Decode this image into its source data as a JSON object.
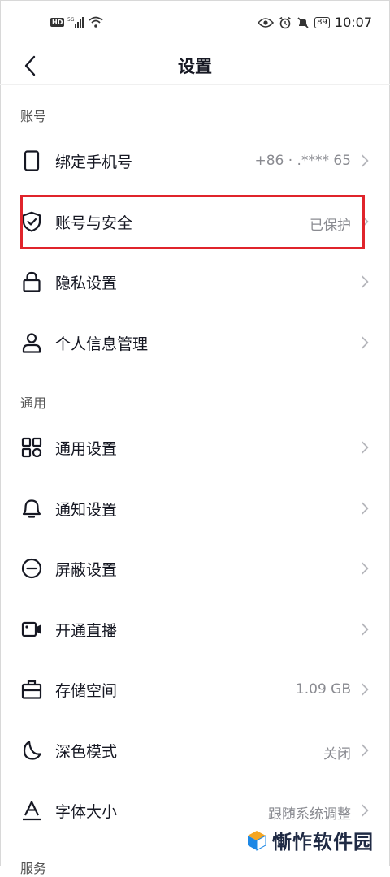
{
  "status_bar": {
    "time": "10:07",
    "battery": "89",
    "network": "5G"
  },
  "header": {
    "title": "设置"
  },
  "sections": {
    "account": {
      "title": "账号",
      "items": [
        {
          "label": "绑定手机号",
          "value": "+86 ·  .****  65",
          "icon": "phone-icon"
        },
        {
          "label": "账号与安全",
          "value": "已保护",
          "icon": "shield-check-icon"
        },
        {
          "label": "隐私设置",
          "value": "",
          "icon": "lock-icon"
        },
        {
          "label": "个人信息管理",
          "value": "",
          "icon": "person-icon"
        }
      ]
    },
    "general": {
      "title": "通用",
      "items": [
        {
          "label": "通用设置",
          "value": "",
          "icon": "grid-icon"
        },
        {
          "label": "通知设置",
          "value": "",
          "icon": "bell-icon"
        },
        {
          "label": "屏蔽设置",
          "value": "",
          "icon": "block-icon"
        },
        {
          "label": "开通直播",
          "value": "",
          "icon": "video-camera-icon"
        },
        {
          "label": "存储空间",
          "value": "1.09 GB",
          "icon": "storage-box-icon"
        },
        {
          "label": "深色模式",
          "value": "关闭",
          "icon": "moon-icon"
        },
        {
          "label": "字体大小",
          "value": "跟随系统调整",
          "icon": "font-size-icon"
        }
      ]
    },
    "next_section_title": "服务"
  },
  "watermark": {
    "text": "慚怍软件园"
  },
  "colors": {
    "highlight": "#e0242b",
    "secondary_text": "#8a8b91",
    "primary_text": "#161823"
  }
}
